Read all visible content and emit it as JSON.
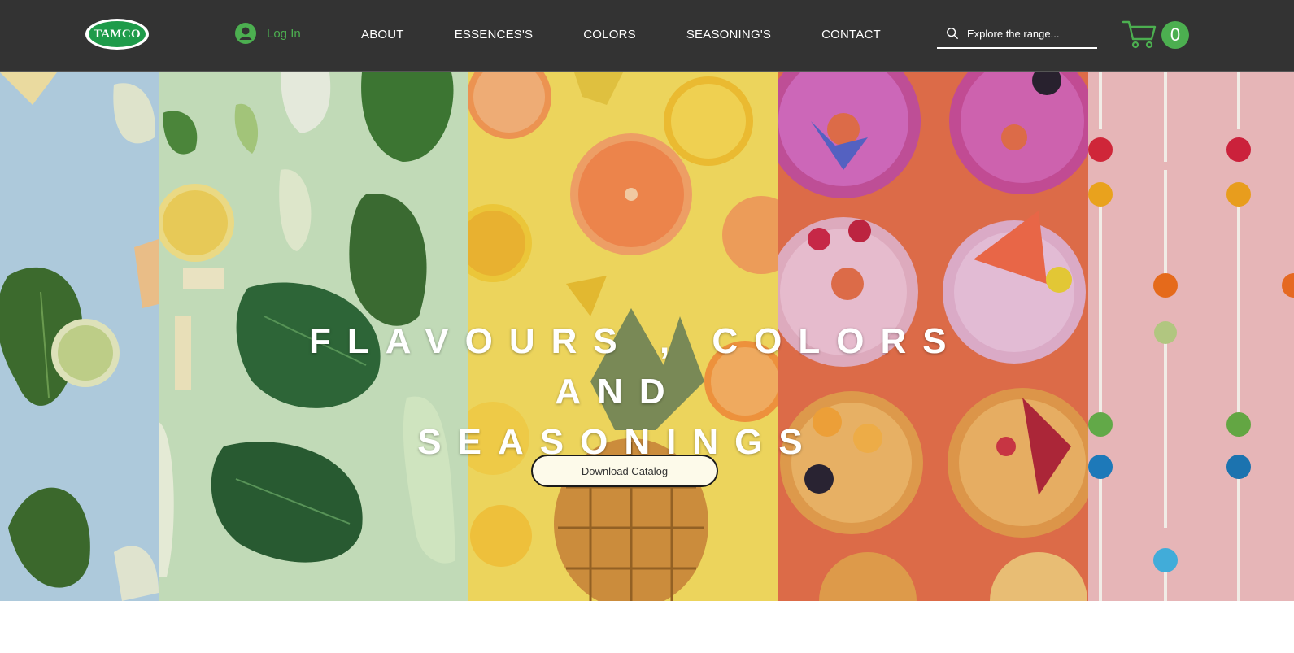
{
  "header": {
    "logo_text": "TAMCO",
    "login_label": "Log In",
    "nav": [
      {
        "label": "ABOUT"
      },
      {
        "label": "ESSENCES'S"
      },
      {
        "label": "COLORS"
      },
      {
        "label": "SEASONING'S"
      },
      {
        "label": "CONTACT"
      }
    ],
    "search": {
      "placeholder": "Explore the range..."
    },
    "cart": {
      "count": "0"
    }
  },
  "hero": {
    "headline": [
      "FLAVOURS , COLORS",
      "AND",
      "SEASONINGS"
    ],
    "cta_label": "Download Catalog",
    "panels": [
      "herbs-on-blue",
      "greens-on-green",
      "citrus-and-pineapple-on-yellow",
      "donuts-on-orange",
      "lollipops-on-pink"
    ]
  },
  "colors": {
    "header_bg": "#333333",
    "accent_green": "#4caf50",
    "hero_text": "#ffffff",
    "cta_bg": "#fdfaea"
  }
}
